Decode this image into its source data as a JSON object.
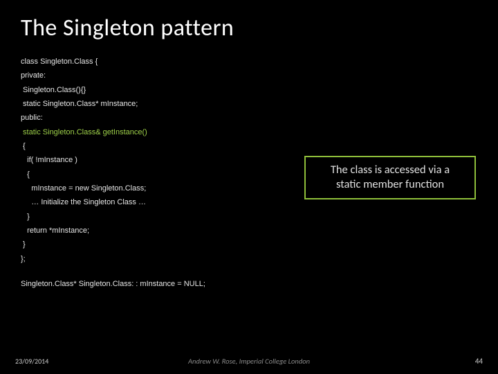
{
  "slide": {
    "title": "The Singleton pattern",
    "code": {
      "l1": "class Singleton.Class {",
      "l2": "private:",
      "l3": " Singleton.Class(){}",
      "l4": " static Singleton.Class* mInstance;",
      "l5": "public:",
      "l6": " static Singleton.Class& getInstance()",
      "l7": " {",
      "l8": "   if( !mInstance )",
      "l9": "   {",
      "l10": "     mInstance = new Singleton.Class;",
      "l11": "     … Initialize the Singleton Class …",
      "l12": "   }",
      "l13": "   return *mInstance;",
      "l14": " }",
      "l15": "};",
      "l16": "Singleton.Class* Singleton.Class: : mInstance = NULL;"
    },
    "callout": {
      "line1": "The class is accessed via a",
      "line2": "static member function"
    },
    "footer": {
      "date": "23/09/2014",
      "author": "Andrew W. Rose, Imperial College London",
      "page": "44"
    }
  }
}
